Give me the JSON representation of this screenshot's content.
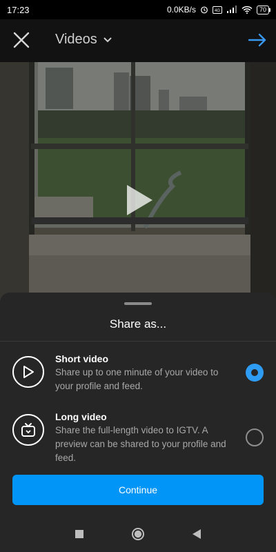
{
  "status_bar": {
    "time": "17:23",
    "network_speed": "0.0KB/s",
    "battery": "70"
  },
  "header": {
    "title": "Videos",
    "close_icon": "close-icon",
    "dropdown_icon": "chevron-down-icon",
    "next_icon": "arrow-right-icon",
    "next_color": "#3897f0"
  },
  "preview": {
    "play_icon": "play-icon"
  },
  "sheet": {
    "title": "Share as...",
    "options": [
      {
        "title": "Short video",
        "description": "Share up to one minute of your video to your profile and feed.",
        "icon": "play-circle-icon",
        "selected": true
      },
      {
        "title": "Long video",
        "description": "Share the full-length video to IGTV. A preview can be shared to your profile and feed.",
        "icon": "igtv-icon",
        "selected": false
      }
    ],
    "continue_label": "Continue",
    "accent_color": "#0095f6"
  },
  "nav_bar": {
    "buttons": [
      "recents-icon",
      "home-icon",
      "back-icon"
    ]
  }
}
